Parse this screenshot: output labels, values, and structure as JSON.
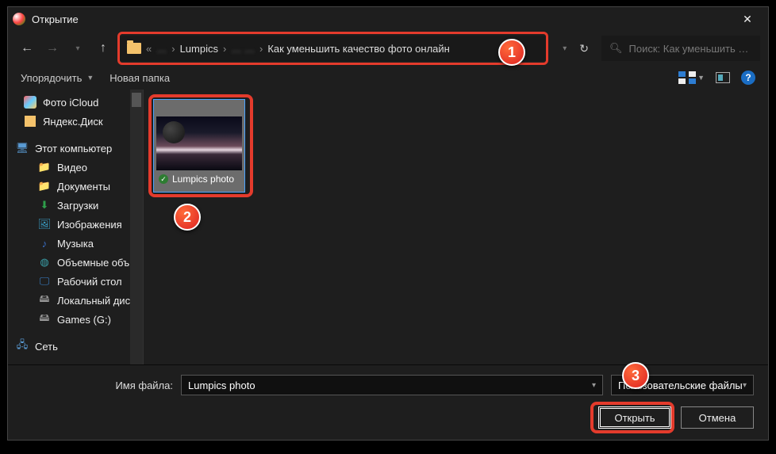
{
  "window": {
    "title": "Открытие"
  },
  "breadcrumb": {
    "preblur": "…",
    "item1": "Lumpics",
    "midblur": "…     …",
    "item2": "Как уменьшить качество фото онлайн"
  },
  "search": {
    "placeholder": "Поиск: Как уменьшить кач..."
  },
  "toolbar": {
    "organize": "Упорядочить",
    "newfolder": "Новая папка"
  },
  "sidebar": {
    "items": [
      {
        "label": "Фото iCloud",
        "icon": "cloud"
      },
      {
        "label": "Яндекс.Диск",
        "icon": "ydisk"
      },
      {
        "label": "Этот компьютер",
        "icon": "pc"
      },
      {
        "label": "Видео",
        "icon": "generic"
      },
      {
        "label": "Документы",
        "icon": "generic"
      },
      {
        "label": "Загрузки",
        "icon": "dl"
      },
      {
        "label": "Изображения",
        "icon": "img"
      },
      {
        "label": "Музыка",
        "icon": "mus"
      },
      {
        "label": "Объемные объ",
        "icon": "3d"
      },
      {
        "label": "Рабочий стол",
        "icon": "desk"
      },
      {
        "label": "Локальный дис",
        "icon": "disk"
      },
      {
        "label": "Games (G:)",
        "icon": "disk"
      },
      {
        "label": "Сеть",
        "icon": "net"
      }
    ]
  },
  "file": {
    "name": "Lumpics photo"
  },
  "footer": {
    "filename_label": "Имя файла:",
    "filename_value": "Lumpics photo",
    "filter_value": "Пользовательские файлы",
    "open": "Открыть",
    "cancel": "Отмена"
  },
  "badges": {
    "b1": "1",
    "b2": "2",
    "b3": "3"
  }
}
